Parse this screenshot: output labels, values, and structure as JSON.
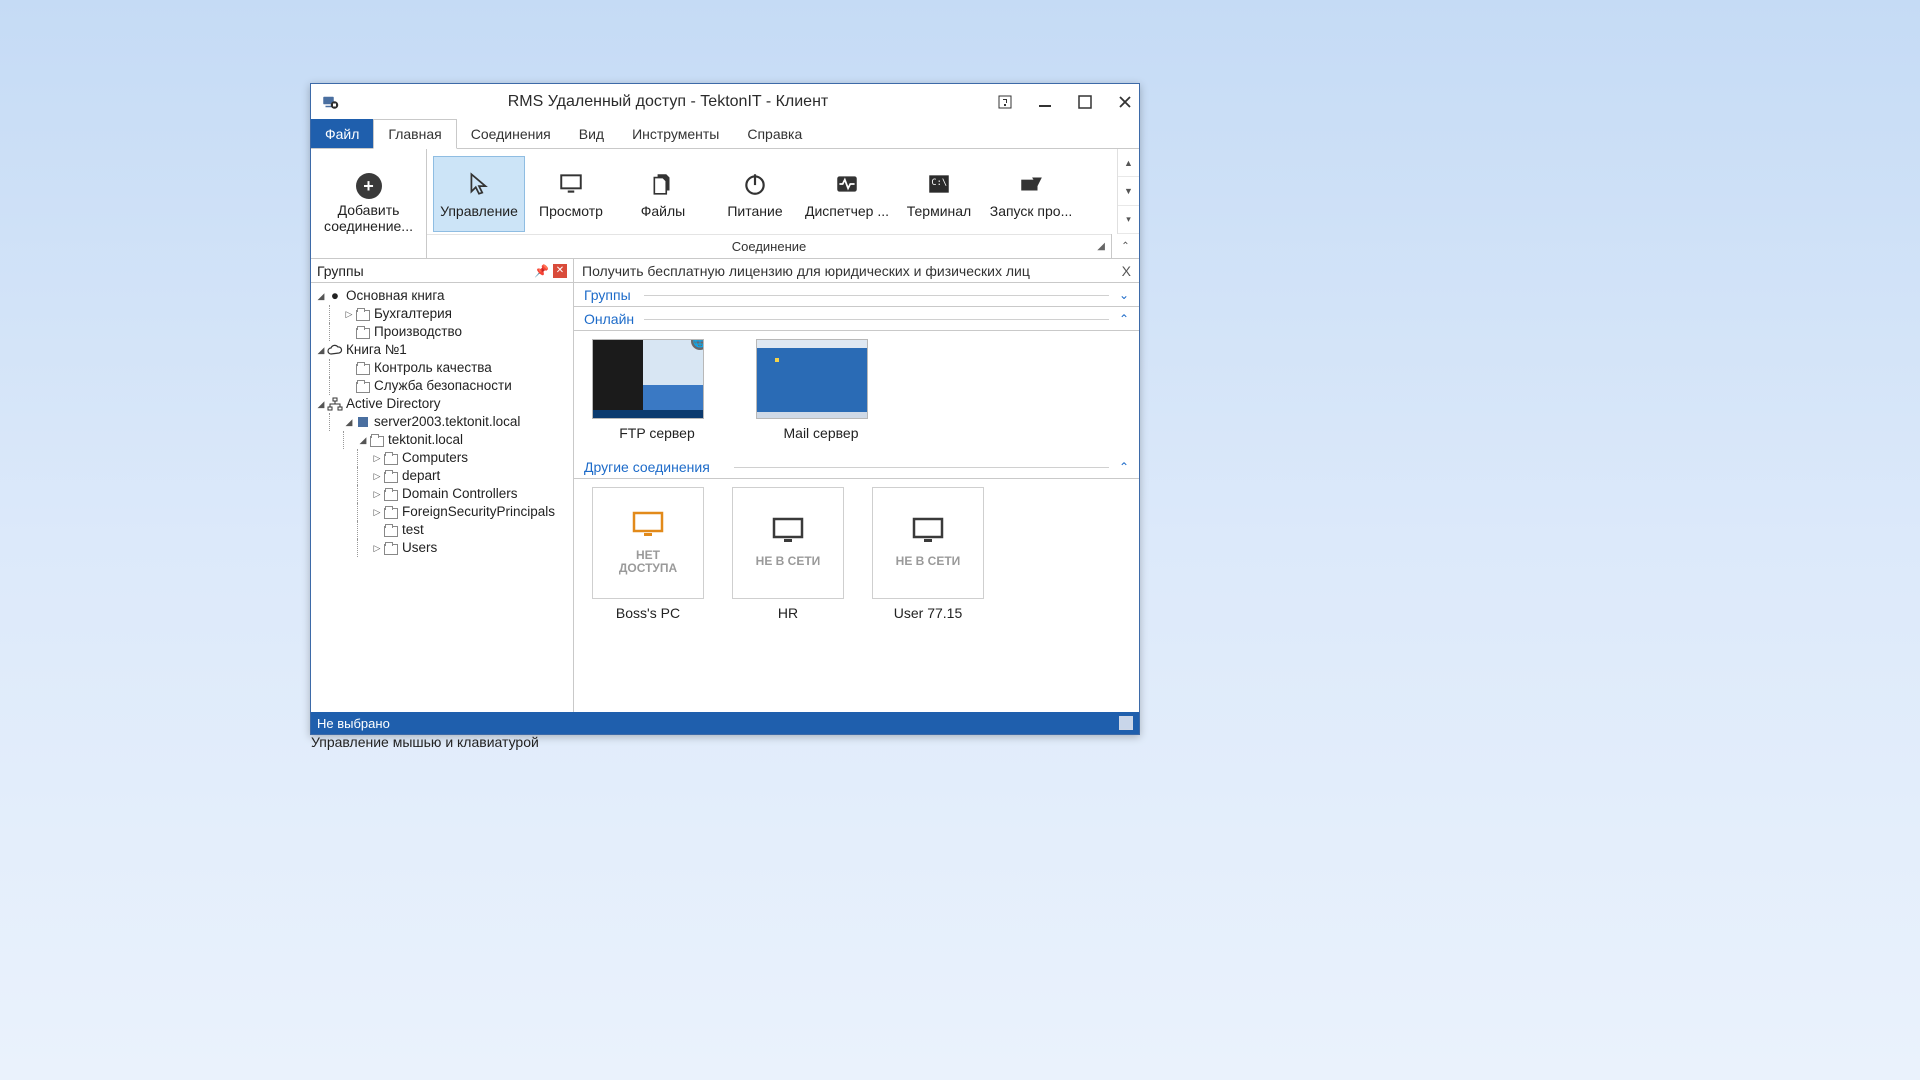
{
  "window": {
    "title": "RMS Удаленный доступ - TektonIT - Клиент"
  },
  "menu": {
    "file": "Файл",
    "main": "Главная",
    "connections": "Соединения",
    "view": "Вид",
    "tools": "Инструменты",
    "help": "Справка"
  },
  "ribbon": {
    "add": {
      "line1": "Добавить",
      "line2": "соединение..."
    },
    "tools": [
      {
        "key": "manage",
        "label": "Управление"
      },
      {
        "key": "view",
        "label": "Просмотр"
      },
      {
        "key": "files",
        "label": "Файлы"
      },
      {
        "key": "power",
        "label": "Питание"
      },
      {
        "key": "taskmgr",
        "label": "Диспетчер ..."
      },
      {
        "key": "terminal",
        "label": "Терминал"
      },
      {
        "key": "run",
        "label": "Запуск про..."
      }
    ],
    "terminal_badge": "C:\\",
    "caption": "Соединение"
  },
  "tree": {
    "title": "Группы",
    "items": {
      "main_book": "Основная книга",
      "acct": "Бухгалтерия",
      "prod": "Производство",
      "book1": "Книга №1",
      "qc": "Контроль качества",
      "security": "Служба безопасности",
      "ad": "Active Directory",
      "server": "server2003.tektonit.local",
      "domain": "tektonit.local",
      "computers": "Computers",
      "depart": "depart",
      "dc": "Domain Controllers",
      "fsp": "ForeignSecurityPrincipals",
      "test": "test",
      "users": "Users"
    }
  },
  "notice": {
    "text": "Получить бесплатную лицензию для юридических и физических лиц"
  },
  "sections": {
    "groups": "Группы",
    "online": "Онлайн",
    "other": "Другие соединения"
  },
  "online": [
    {
      "label": "FTP сервер"
    },
    {
      "label": "Mail сервер"
    }
  ],
  "other": [
    {
      "label": "Boss's PC",
      "status1": "НЕТ",
      "status2": "ДОСТУПА",
      "color": "#e28a1a"
    },
    {
      "label": "HR",
      "status1": "НЕ В СЕТИ",
      "status2": "",
      "color": "#3a3a3a"
    },
    {
      "label": "User 77.15",
      "status1": "НЕ В СЕТИ",
      "status2": "",
      "color": "#3a3a3a"
    }
  ],
  "status": {
    "left": "Не выбрано",
    "center": "Управление мышью и клавиатурой"
  }
}
